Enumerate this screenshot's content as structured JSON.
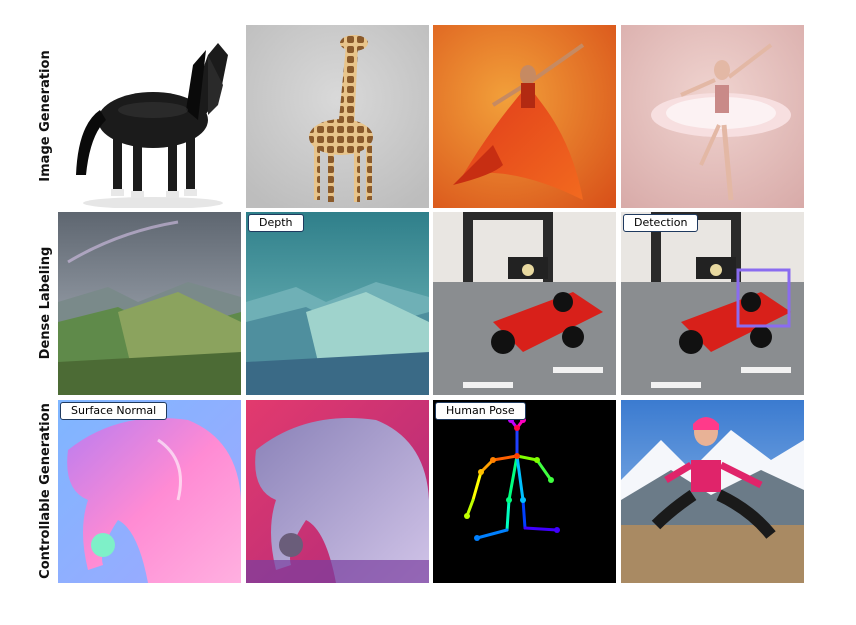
{
  "rows": [
    {
      "label": "Image Generation"
    },
    {
      "label": "Dense Labeling"
    },
    {
      "label": "Controllable Generation"
    }
  ],
  "tags": {
    "depth": "Depth",
    "detection": "Detection",
    "surface_normal": "Surface Normal",
    "human_pose": "Human Pose"
  },
  "images": {
    "r1c1": "black horse",
    "r1c2": "giraffe",
    "r1c3": "dancer in red dress",
    "r1c4": "ballerina in pink tutu",
    "r2c1": "mountain valley",
    "r2c2": "depth map of mountain valley",
    "r2c3": "toy race car",
    "r2c4": "toy race car with detection box",
    "r3c1": "surface normal map of elephant",
    "r3c2": "stylized elephant",
    "r3c3": "human pose skeleton",
    "r3c4": "woman jumping in mountains"
  },
  "colors": {
    "tag_border": "#1f3a5f",
    "detection_box": "#8a6cf0"
  }
}
